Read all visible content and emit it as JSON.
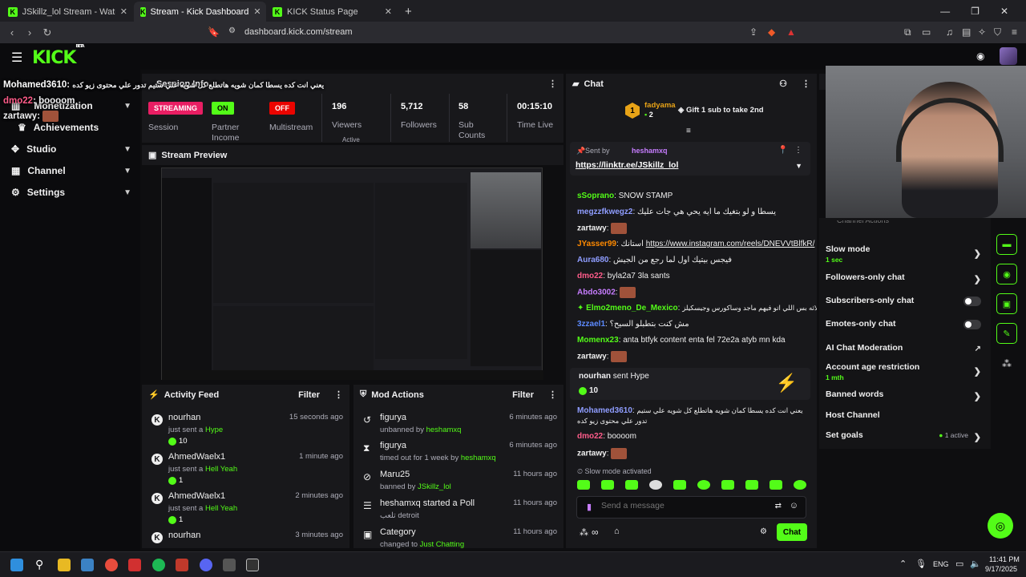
{
  "browser": {
    "tabs": [
      {
        "title": "JSkillz_lol Stream - Watch Live on Kic",
        "active": false
      },
      {
        "title": "Stream - Kick Dashboard",
        "active": true
      },
      {
        "title": "KICK Status Page",
        "active": false
      }
    ],
    "new_tab": "+",
    "url": "dashboard.kick.com/stream"
  },
  "kick": {
    "logo": "KICK",
    "logo_sup": "BETA"
  },
  "sidebar": {
    "items": [
      {
        "label": "Monetization",
        "icon": "monetization-icon"
      },
      {
        "label": "Achievements",
        "icon": "trophy-icon"
      },
      {
        "label": "Studio",
        "icon": "studio-icon"
      },
      {
        "label": "Channel",
        "icon": "channel-icon"
      },
      {
        "label": "Settings",
        "icon": "gear-icon"
      }
    ]
  },
  "overlay_chat": [
    {
      "user": "Mohamed3610",
      "text": "يعني انت كده يسطا كمان شويه هاتطلع كل شويه علي ستيم تدور علي محتوى زيو كده",
      "color": "#ffffff"
    },
    {
      "user": "dmo22",
      "text": "boooom",
      "color": "#ff5c8a"
    },
    {
      "user": "zartawy",
      "text": "",
      "color": "#ffffff"
    }
  ],
  "session": {
    "title": "Session Info",
    "badges": {
      "streaming": "STREAMING",
      "partner": "ON",
      "multistream": "OFF"
    },
    "labels": {
      "session": "Session",
      "partner": "Partner Income",
      "multistream": "Multistream"
    },
    "stats": [
      {
        "value": "196",
        "label": "Viewers"
      },
      {
        "value": "5,712",
        "label": "Followers"
      },
      {
        "value": "58",
        "label": "Sub Counts"
      },
      {
        "value": "00:15:10",
        "label": "Time Live"
      }
    ],
    "active_hint": "Active"
  },
  "preview": {
    "title": "Stream Preview"
  },
  "activity": {
    "title": "Activity Feed",
    "filter": "Filter",
    "items": [
      {
        "name": "nourhan",
        "time": "15 seconds ago",
        "pre": "just sent a",
        "hl": "Hype",
        "count": "10"
      },
      {
        "name": "AhmedWaelx1",
        "time": "1 minute ago",
        "pre": "just sent a",
        "hl": "Hell Yeah",
        "count": "1"
      },
      {
        "name": "AhmedWaelx1",
        "time": "2 minutes ago",
        "pre": "just sent a",
        "hl": "Hell Yeah",
        "count": "1"
      },
      {
        "name": "nourhan",
        "time": "3 minutes ago",
        "pre": "",
        "hl": "",
        "count": ""
      }
    ]
  },
  "mod": {
    "title": "Mod Actions",
    "filter": "Filter",
    "items": [
      {
        "name": "figurya",
        "time": "6 minutes ago",
        "pre": "unbanned by",
        "hl": "heshamxq",
        "icon": "unban-icon",
        "glyph": "↺"
      },
      {
        "name": "figurya",
        "time": "6 minutes ago",
        "pre": "timed out for 1 week by",
        "hl": "heshamxq",
        "icon": "hourglass-icon",
        "glyph": "⧗"
      },
      {
        "name": "Maru25",
        "time": "11 hours ago",
        "pre": "banned by",
        "hl": "JSkillz_lol",
        "icon": "ban-icon",
        "glyph": "⊘"
      },
      {
        "name": "heshamxq started a Poll",
        "time": "11 hours ago",
        "pre": "تلعب detroit",
        "hl": "",
        "icon": "poll-icon",
        "glyph": "☰"
      },
      {
        "name": "Category",
        "time": "11 hours ago",
        "pre": "changed to",
        "hl": "Just Chatting",
        "icon": "category-icon",
        "glyph": "▣"
      }
    ]
  },
  "chat": {
    "title": "Chat",
    "leader": {
      "rank": "1",
      "name": "fadyama",
      "subs": "2",
      "gift_text": "Gift 1 sub to take 2nd"
    },
    "pinned": {
      "sent_by": "Sent by",
      "user": "heshamxq",
      "link": "https://linktr.ee/JSkillz_lol"
    },
    "messages": [
      {
        "user": "sSoprano",
        "color": "#53fc18",
        "text": "SNOW STAMP",
        "emote": false
      },
      {
        "user": "megzzfkwegz2",
        "color": "#8f9dff",
        "text": "يسطا و لو بتغيك ما ايه يحي هي جات عليك",
        "emote": false
      },
      {
        "user": "zartawy",
        "color": "#efefef",
        "text": "",
        "emote": true
      },
      {
        "user": "JYasser99",
        "color": "#ff8a00",
        "text": "استانك",
        "link": "https://www.instagram.com/reels/DNEVVtBlfkR/",
        "emote": false
      },
      {
        "user": "Aura680",
        "color": "#8f9dff",
        "text": "فيجس بيتيك اول لما رجع من الجيش",
        "emote": false
      },
      {
        "user": "dmo22",
        "color": "#ff5c8a",
        "text": "byla2a7 3la sants",
        "emote": false
      },
      {
        "user": "Abdo3002",
        "color": "#c77dff",
        "text": "",
        "emote": true
      },
      {
        "user": "Elmo2meno_De_Mexico",
        "color": "#53fc18",
        "text": "هما ثلاثه بس اللي اتو فيهم ماجد وساكورس وجيسكيلز",
        "emote": false
      },
      {
        "user": "3zzael1",
        "color": "#5c8aff",
        "text": "مش كنت بتطبلو السيح؟",
        "emote": false
      },
      {
        "user": "Momenx23",
        "color": "#53fc18",
        "text": "anta btfyk content enta fel 72e2a atyb mn kda",
        "emote": false
      },
      {
        "user": "zartawy",
        "color": "#efefef",
        "text": "",
        "emote": true
      }
    ],
    "hype": {
      "user": "nourhan",
      "text": "sent Hype",
      "count": "10"
    },
    "messages2": [
      {
        "user": "Mohamed3610",
        "color": "#8f9dff",
        "text": "يعني انت كده يسطا كمان شويه هاتطلع كل شويه علي ستيم تدور علي",
        "text2": "محتوى زيو كده",
        "emote": false
      },
      {
        "user": "dmo22",
        "color": "#ff5c8a",
        "text": "boooom",
        "emote": false
      },
      {
        "user": "zartawy",
        "color": "#efefef",
        "text": "",
        "emote": true
      }
    ],
    "slow_mode": "Slow mode activated",
    "input_placeholder": "Send a message",
    "send": "Chat"
  },
  "settings_panel": {
    "header_partial": "Channel Actions",
    "rows": [
      {
        "label": "Slow mode",
        "value": "1 sec",
        "control": "chevron"
      },
      {
        "label": "Followers-only chat",
        "value": "",
        "control": "chevron"
      },
      {
        "label": "Subscribers-only chat",
        "value": "",
        "control": "toggle"
      },
      {
        "label": "Emotes-only chat",
        "value": "",
        "control": "toggle"
      },
      {
        "label": "AI Chat Moderation",
        "value": "",
        "control": "external"
      },
      {
        "label": "Account age restriction",
        "value": "1 mth",
        "control": "chevron"
      },
      {
        "label": "Banned words",
        "value": "",
        "control": "chevron"
      },
      {
        "label": "Host Channel",
        "value": "",
        "control": "none"
      },
      {
        "label": "Set goals",
        "value": "",
        "control": "chevron",
        "status": "1 active"
      }
    ]
  },
  "taskbar": {
    "lang": "ENG",
    "time": "11:41 PM",
    "date": "9/17/2025"
  },
  "colors": {
    "accent": "#53fc18",
    "panel": "#18181b",
    "bg": "#0e0e10",
    "red": "#eb0400"
  }
}
